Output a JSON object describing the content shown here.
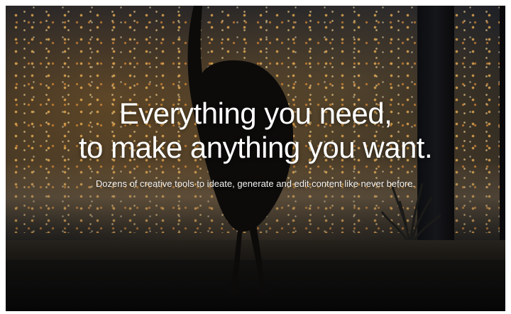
{
  "hero": {
    "headline_line1": "Everything you need,",
    "headline_line2": "to make anything you want.",
    "subheadline": "Dozens of creative tools to ideate, generate and edit content like never before."
  },
  "background": {
    "scene": "night-city-window-with-bird-silhouette",
    "accent_light_color": "#ffb24d",
    "text_color": "#ffffff"
  }
}
